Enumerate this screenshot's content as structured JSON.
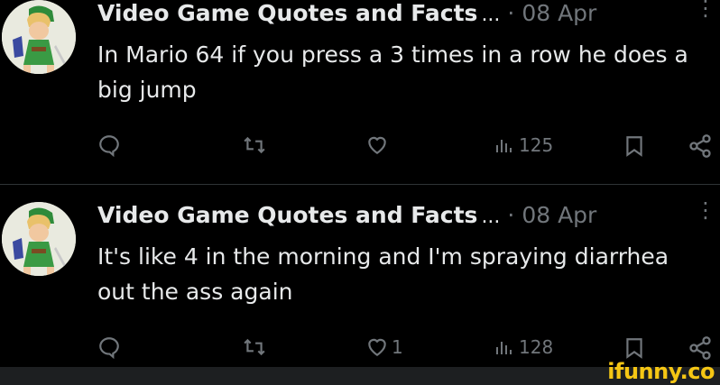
{
  "tweets": [
    {
      "author": "Video Game Quotes and Facts",
      "ellipsis": "...",
      "date": "· 08 Apr",
      "text": "In Mario 64 if you press a 3 times in a row he does a big jump",
      "like_count": "",
      "view_count": "125"
    },
    {
      "author": "Video Game Quotes and Facts",
      "ellipsis": "...",
      "date": "· 08 Apr",
      "text": "It's like 4 in the morning and I'm spraying diarrhea out the ass again",
      "like_count": "1",
      "view_count": "128"
    }
  ],
  "more_icon": "⋮",
  "icons": [
    "reply-icon",
    "retweet-icon",
    "like-icon",
    "views-icon",
    "bookmark-icon",
    "share-icon"
  ],
  "watermark": "ifunny.co",
  "colors": {
    "background": "#000000",
    "text": "#e7e9ea",
    "muted": "#71767b",
    "watermark": "#f5c614"
  }
}
